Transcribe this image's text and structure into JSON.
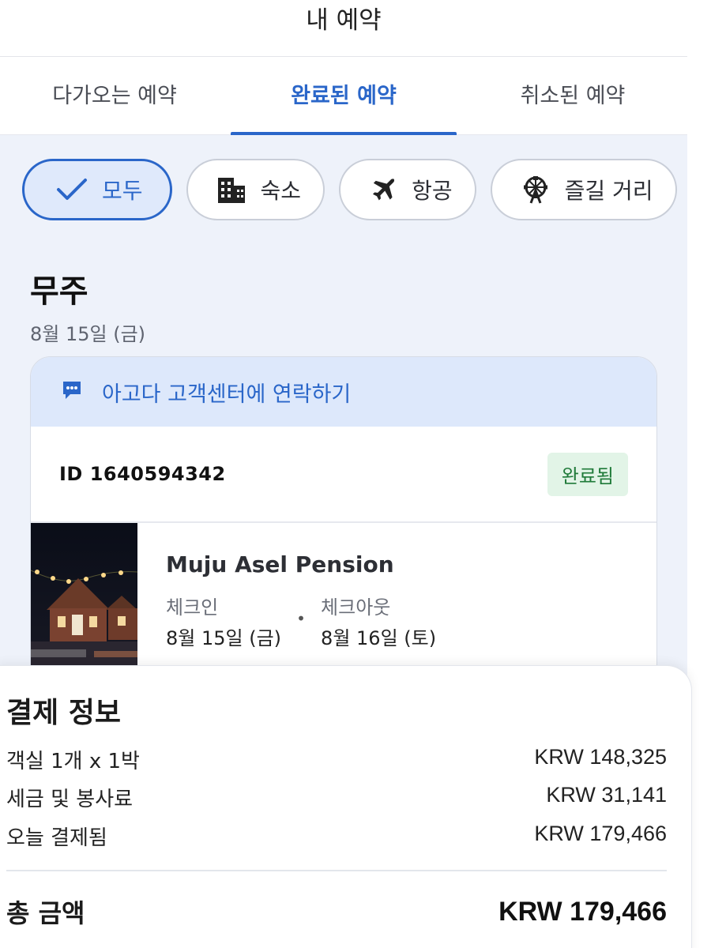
{
  "header": {
    "title": "내 예약"
  },
  "tabs": [
    {
      "label": "다가오는 예약",
      "active": false
    },
    {
      "label": "완료된 예약",
      "active": true
    },
    {
      "label": "취소된 예약",
      "active": false
    }
  ],
  "filters": [
    {
      "label": "모두",
      "icon": "check-icon",
      "selected": true
    },
    {
      "label": "숙소",
      "icon": "building-icon",
      "selected": false
    },
    {
      "label": "항공",
      "icon": "airplane-icon",
      "selected": false
    },
    {
      "label": "즐길 거리",
      "icon": "ferris-wheel-icon",
      "selected": false
    }
  ],
  "trip": {
    "location": "무주",
    "date": "8월 15일 (금)"
  },
  "booking": {
    "contact_label": "아고다 고객센터에 연락하기",
    "id": "ID 1640594342",
    "status": "완료됨",
    "hotel_name": "Muju Asel Pension",
    "checkin_label": "체크인",
    "checkin_date": "8월 15일 (금)",
    "checkout_label": "체크아웃",
    "checkout_date": "8월 16일 (토)"
  },
  "payment": {
    "title": "결제 정보",
    "rows": [
      {
        "label": "객실 1개 x 1박",
        "amount": "KRW 148,325"
      },
      {
        "label": "세금 및 봉사료",
        "amount": "KRW 31,141"
      },
      {
        "label": "오늘 결제됨",
        "amount": "KRW 179,466"
      }
    ],
    "total_label": "총 금액",
    "total_amount": "KRW 179,466"
  },
  "colors": {
    "accent": "#2a66c9",
    "status_green": "#1f7a39",
    "background": "#eef2fa"
  }
}
